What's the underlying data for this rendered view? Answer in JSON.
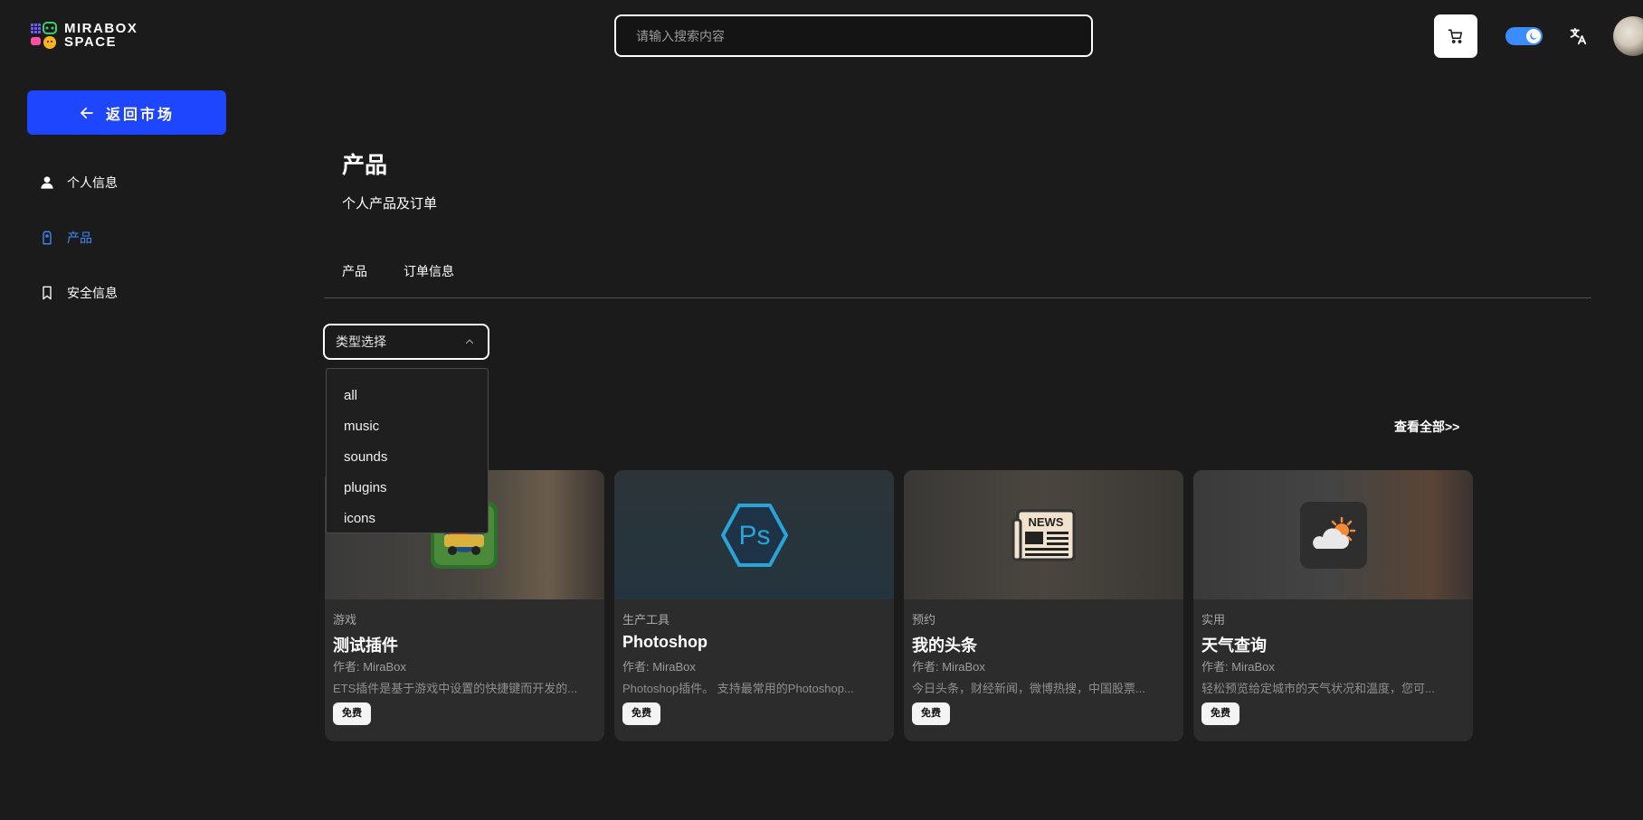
{
  "header": {
    "logo_line1": "MIRABOX",
    "logo_line2": "SPACE",
    "search_placeholder": "请输入搜索内容",
    "toggle_on": true,
    "accent_color": "#3b8cff"
  },
  "sidebar": {
    "back_label": "返回市场",
    "back_button_color": "#1f46ff",
    "items": [
      {
        "label": "个人信息",
        "icon": "user-icon",
        "active": false
      },
      {
        "label": "产品",
        "icon": "tag-icon",
        "active": true
      },
      {
        "label": "安全信息",
        "icon": "bookmark-icon",
        "active": false
      }
    ]
  },
  "main": {
    "title": "产品",
    "subtitle": "个人产品及订单",
    "tabs": [
      {
        "label": "产品"
      },
      {
        "label": "订单信息"
      }
    ],
    "filter": {
      "placeholder": "类型选择",
      "expanded": true,
      "options": [
        "all",
        "music",
        "sounds",
        "plugins",
        "icons"
      ]
    },
    "view_all_label": "查看全部>>",
    "cards": [
      {
        "category": "游戏",
        "name": "测试插件",
        "author": "作者: MiraBox",
        "description": "ETS插件是基于游戏中设置的快捷键而开发的...",
        "price": "免费",
        "icon": "euro-truck-icon"
      },
      {
        "category": "生产工具",
        "name": "Photoshop",
        "author": "作者: MiraBox",
        "description": "Photoshop插件。 支持最常用的Photoshop...",
        "price": "免费",
        "icon": "photoshop-icon"
      },
      {
        "category": "预约",
        "name": "我的头条",
        "author": "作者: MiraBox",
        "description": "今日头条，财经新闻，微博热搜，中国股票...",
        "price": "免费",
        "icon": "news-icon"
      },
      {
        "category": "实用",
        "name": "天气查询",
        "author": "作者: MiraBox",
        "description": "轻松预览给定城市的天气状况和温度，您可...",
        "price": "免费",
        "icon": "weather-icon"
      }
    ]
  }
}
